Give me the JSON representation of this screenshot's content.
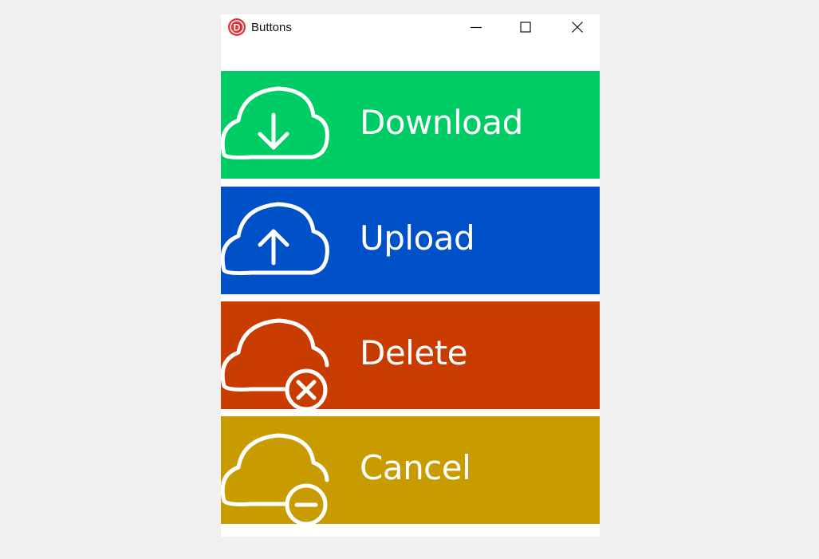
{
  "window": {
    "title": "Buttons",
    "app_icon_letter": "D",
    "controls": {
      "minimize": "minimize",
      "maximize": "maximize",
      "close": "close"
    }
  },
  "buttons": [
    {
      "label": "Download",
      "color": "#00cc66",
      "icon": "cloud-download-icon"
    },
    {
      "label": "Upload",
      "color": "#0050c8",
      "icon": "cloud-upload-icon"
    },
    {
      "label": "Delete",
      "color": "#c83c00",
      "icon": "cloud-delete-icon"
    },
    {
      "label": "Cancel",
      "color": "#c89c00",
      "icon": "cloud-cancel-icon"
    }
  ],
  "colors": {
    "desktop": "#f0f0f0",
    "window": "#ffffff",
    "app_icon": "#e8303a"
  }
}
